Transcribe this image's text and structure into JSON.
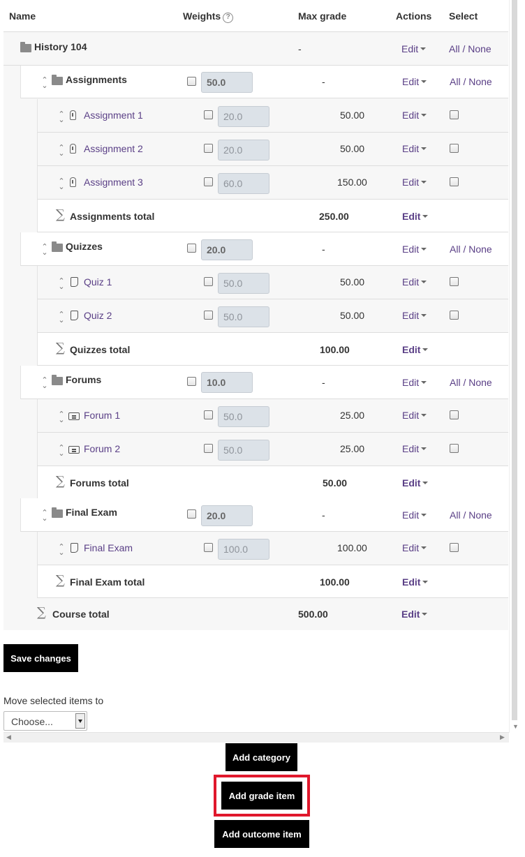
{
  "header": {
    "name": "Name",
    "weights": "Weights",
    "help_glyph": "?",
    "max_grade": "Max grade",
    "actions": "Actions",
    "select": "Select"
  },
  "course": {
    "name": "History 104",
    "max_grade": "-",
    "edit": "Edit",
    "select_all": "All",
    "select_sep": " / ",
    "select_none": "None"
  },
  "categories": [
    {
      "name": "Assignments",
      "weight": "50.0",
      "max_grade": "-",
      "edit": "Edit",
      "select_all": "All",
      "select_none": "None",
      "items": [
        {
          "name": "Assignment 1",
          "weight": "20.0",
          "max_grade": "50.00",
          "edit": "Edit",
          "icon": "assignment-icon"
        },
        {
          "name": "Assignment 2",
          "weight": "20.0",
          "max_grade": "50.00",
          "edit": "Edit",
          "icon": "assignment-icon"
        },
        {
          "name": "Assignment 3",
          "weight": "60.0",
          "max_grade": "150.00",
          "edit": "Edit",
          "icon": "assignment-icon"
        }
      ],
      "total": {
        "name": "Assignments total",
        "max_grade": "250.00",
        "edit": "Edit"
      }
    },
    {
      "name": "Quizzes",
      "weight": "20.0",
      "max_grade": "-",
      "edit": "Edit",
      "select_all": "All",
      "select_none": "None",
      "items": [
        {
          "name": "Quiz 1",
          "weight": "50.0",
          "max_grade": "50.00",
          "edit": "Edit",
          "icon": "quiz-icon"
        },
        {
          "name": "Quiz 2",
          "weight": "50.0",
          "max_grade": "50.00",
          "edit": "Edit",
          "icon": "quiz-icon"
        }
      ],
      "total": {
        "name": "Quizzes total",
        "max_grade": "100.00",
        "edit": "Edit"
      }
    },
    {
      "name": "Forums",
      "weight": "10.0",
      "max_grade": "-",
      "edit": "Edit",
      "select_all": "All",
      "select_none": "None",
      "items": [
        {
          "name": "Forum 1",
          "weight": "50.0",
          "max_grade": "25.00",
          "edit": "Edit",
          "icon": "forum-icon"
        },
        {
          "name": "Forum 2",
          "weight": "50.0",
          "max_grade": "25.00",
          "edit": "Edit",
          "icon": "forum-icon"
        }
      ],
      "total": {
        "name": "Forums total",
        "max_grade": "50.00",
        "edit": "Edit"
      }
    },
    {
      "name": "Final Exam",
      "weight": "20.0",
      "max_grade": "-",
      "edit": "Edit",
      "select_all": "All",
      "select_none": "None",
      "items": [
        {
          "name": "Final Exam",
          "weight": "100.0",
          "max_grade": "100.00",
          "edit": "Edit",
          "icon": "quiz-icon"
        }
      ],
      "total": {
        "name": "Final Exam total",
        "max_grade": "100.00",
        "edit": "Edit"
      }
    }
  ],
  "course_total": {
    "name": "Course total",
    "max_grade": "500.00",
    "edit": "Edit"
  },
  "save_button": "Save changes",
  "move": {
    "label": "Move selected items to",
    "selected": "Choose..."
  },
  "buttons": {
    "add_category": "Add category",
    "add_grade_item": "Add grade item",
    "add_outcome_item": "Add outcome item"
  },
  "colors": {
    "link": "#5a3f86",
    "button_bg": "#000000",
    "highlight": "#e0182c",
    "weight_box": "#dce2e8"
  }
}
